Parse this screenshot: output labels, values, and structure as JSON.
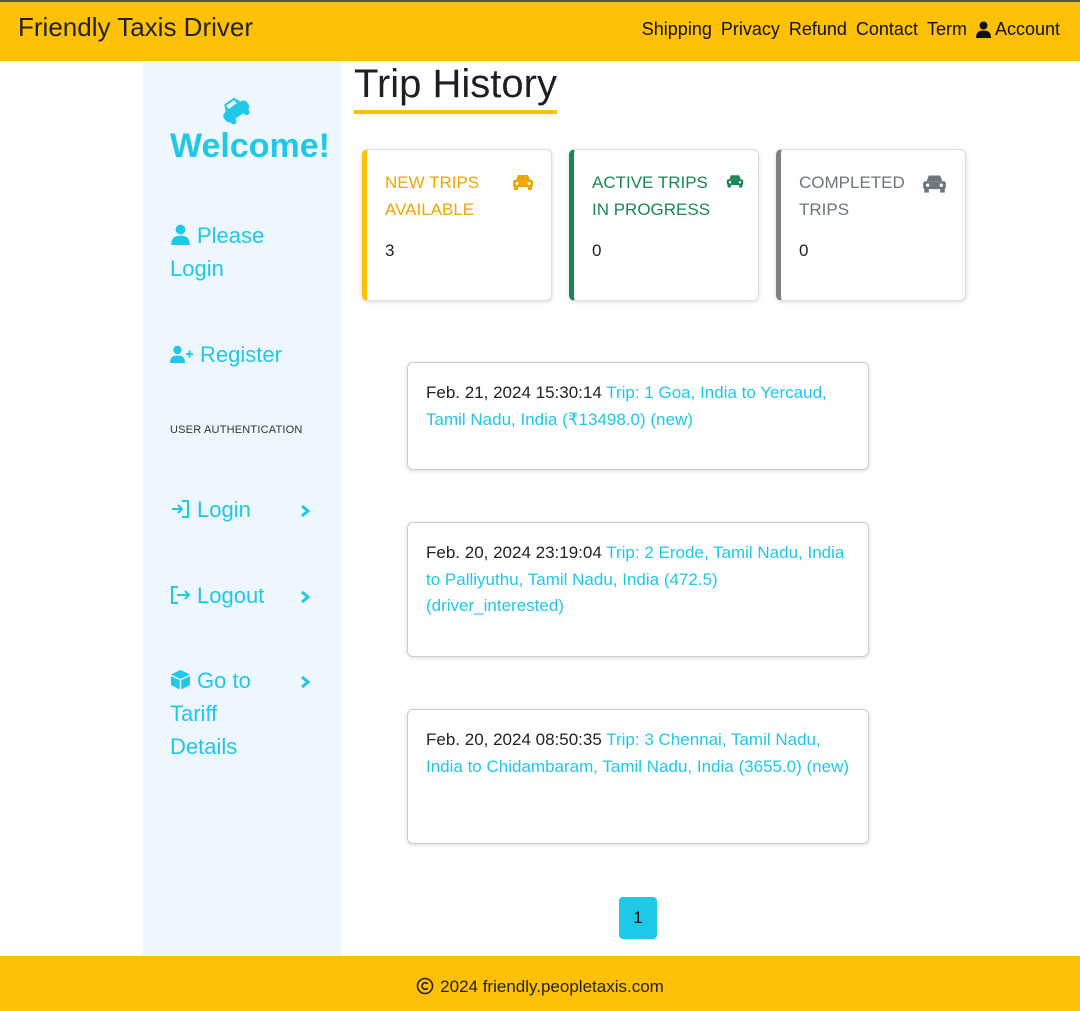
{
  "header": {
    "brand": "Friendly Taxis Driver",
    "nav": {
      "shipping": "Shipping",
      "privacy": "Privacy",
      "refund": "Refund",
      "contact": "Contact",
      "term": "Term",
      "account": "Account"
    }
  },
  "sidebar": {
    "welcome": "Welcome!",
    "please_login": "Please Login",
    "register": "Register",
    "section_heading": "USER AUTHENTICATION",
    "login": "Login",
    "logout": "Logout",
    "tariff": "Go to Tariff Details"
  },
  "main": {
    "title": "Trip History",
    "stats": [
      {
        "label": "NEW TRIPS AVAILABLE",
        "count": "3",
        "color": "#ffc107"
      },
      {
        "label": "ACTIVE TRIPS IN PROGRESS",
        "count": "0",
        "color": "#198754"
      },
      {
        "label": "COMPLETED TRIPS",
        "count": "0",
        "color": "#808080"
      }
    ],
    "trips": [
      {
        "date": "Feb. 21, 2024 15:30:14",
        "link": "Trip: 1 Goa, India to Yercaud, Tamil Nadu, India (₹13498.0) (new)"
      },
      {
        "date": "Feb. 20, 2024 23:19:04",
        "link": "Trip: 2 Erode, Tamil Nadu, India to Palliyuthu, Tamil Nadu, India (472.5) (driver_interested)"
      },
      {
        "date": "Feb. 20, 2024 08:50:35",
        "link": "Trip: 3 Chennai, Tamil Nadu, India to Chidambaram, Tamil Nadu, India (3655.0) (new)"
      }
    ],
    "pagination": {
      "current": "1"
    }
  },
  "footer": {
    "text": "2024 friendly.peopletaxis.com"
  },
  "colors": {
    "accent": "#ffc107",
    "link": "#1ec8e6",
    "sidebar_bg": "#eef7fd"
  }
}
